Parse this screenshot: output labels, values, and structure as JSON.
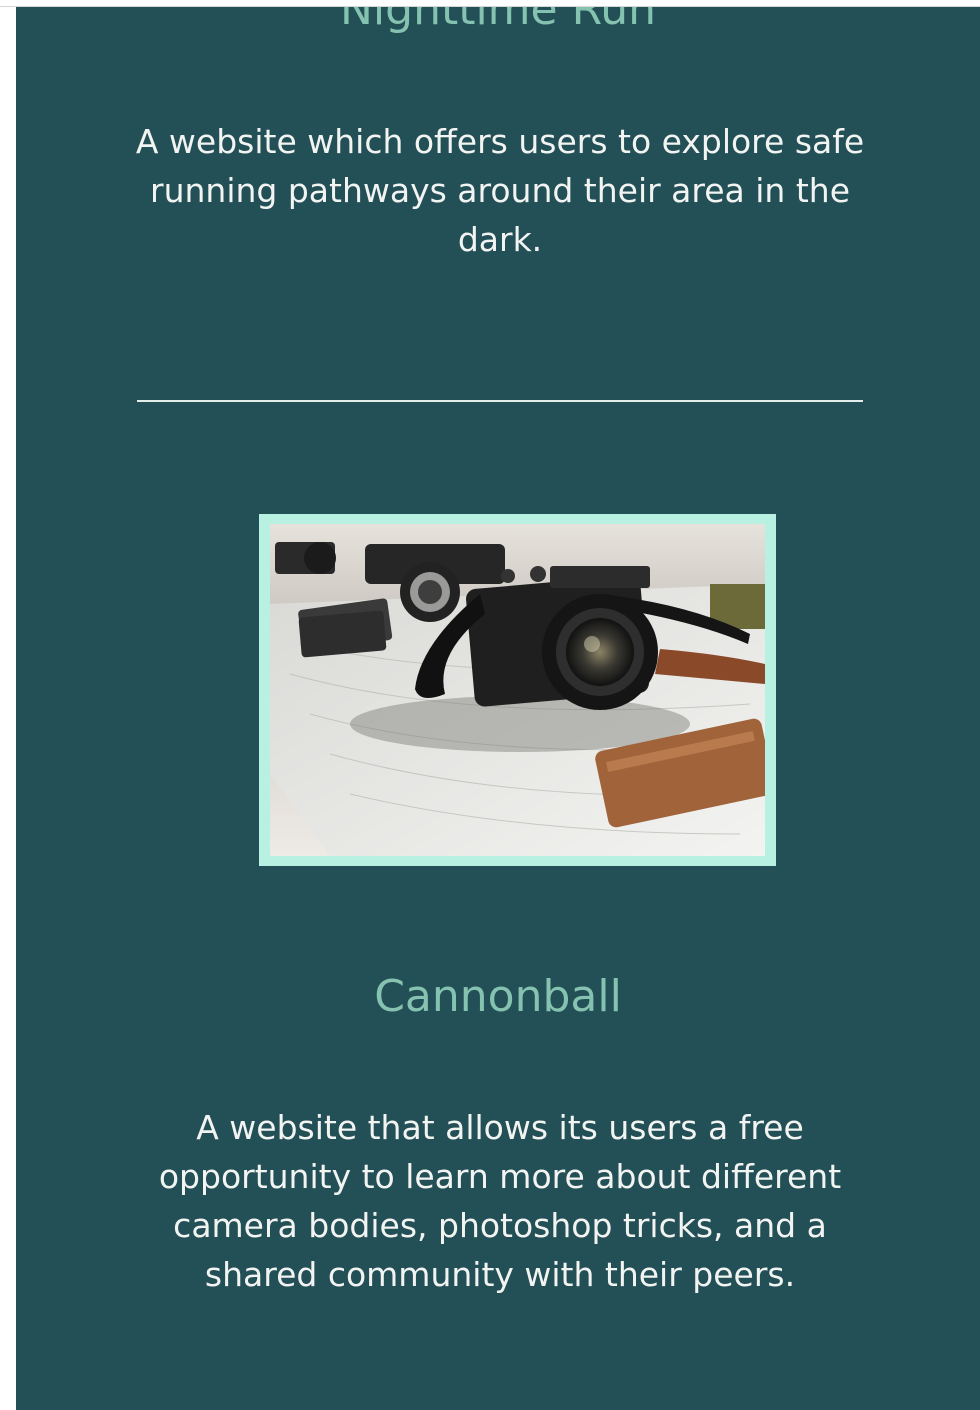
{
  "projects": [
    {
      "title": "Nighttime Run",
      "description": "A website which offers users to explore safe running pathways around their area in the dark."
    },
    {
      "title": "Cannonball",
      "description": "A website that allows its users a free opportunity to learn more about different camera bodies, photoshop tricks, and a shared community with their peers."
    }
  ],
  "colors": {
    "panel_background": "#234f57",
    "title_accent": "#86c2b0",
    "image_border": "#b8f0e2",
    "body_text": "#f2f4f2"
  }
}
